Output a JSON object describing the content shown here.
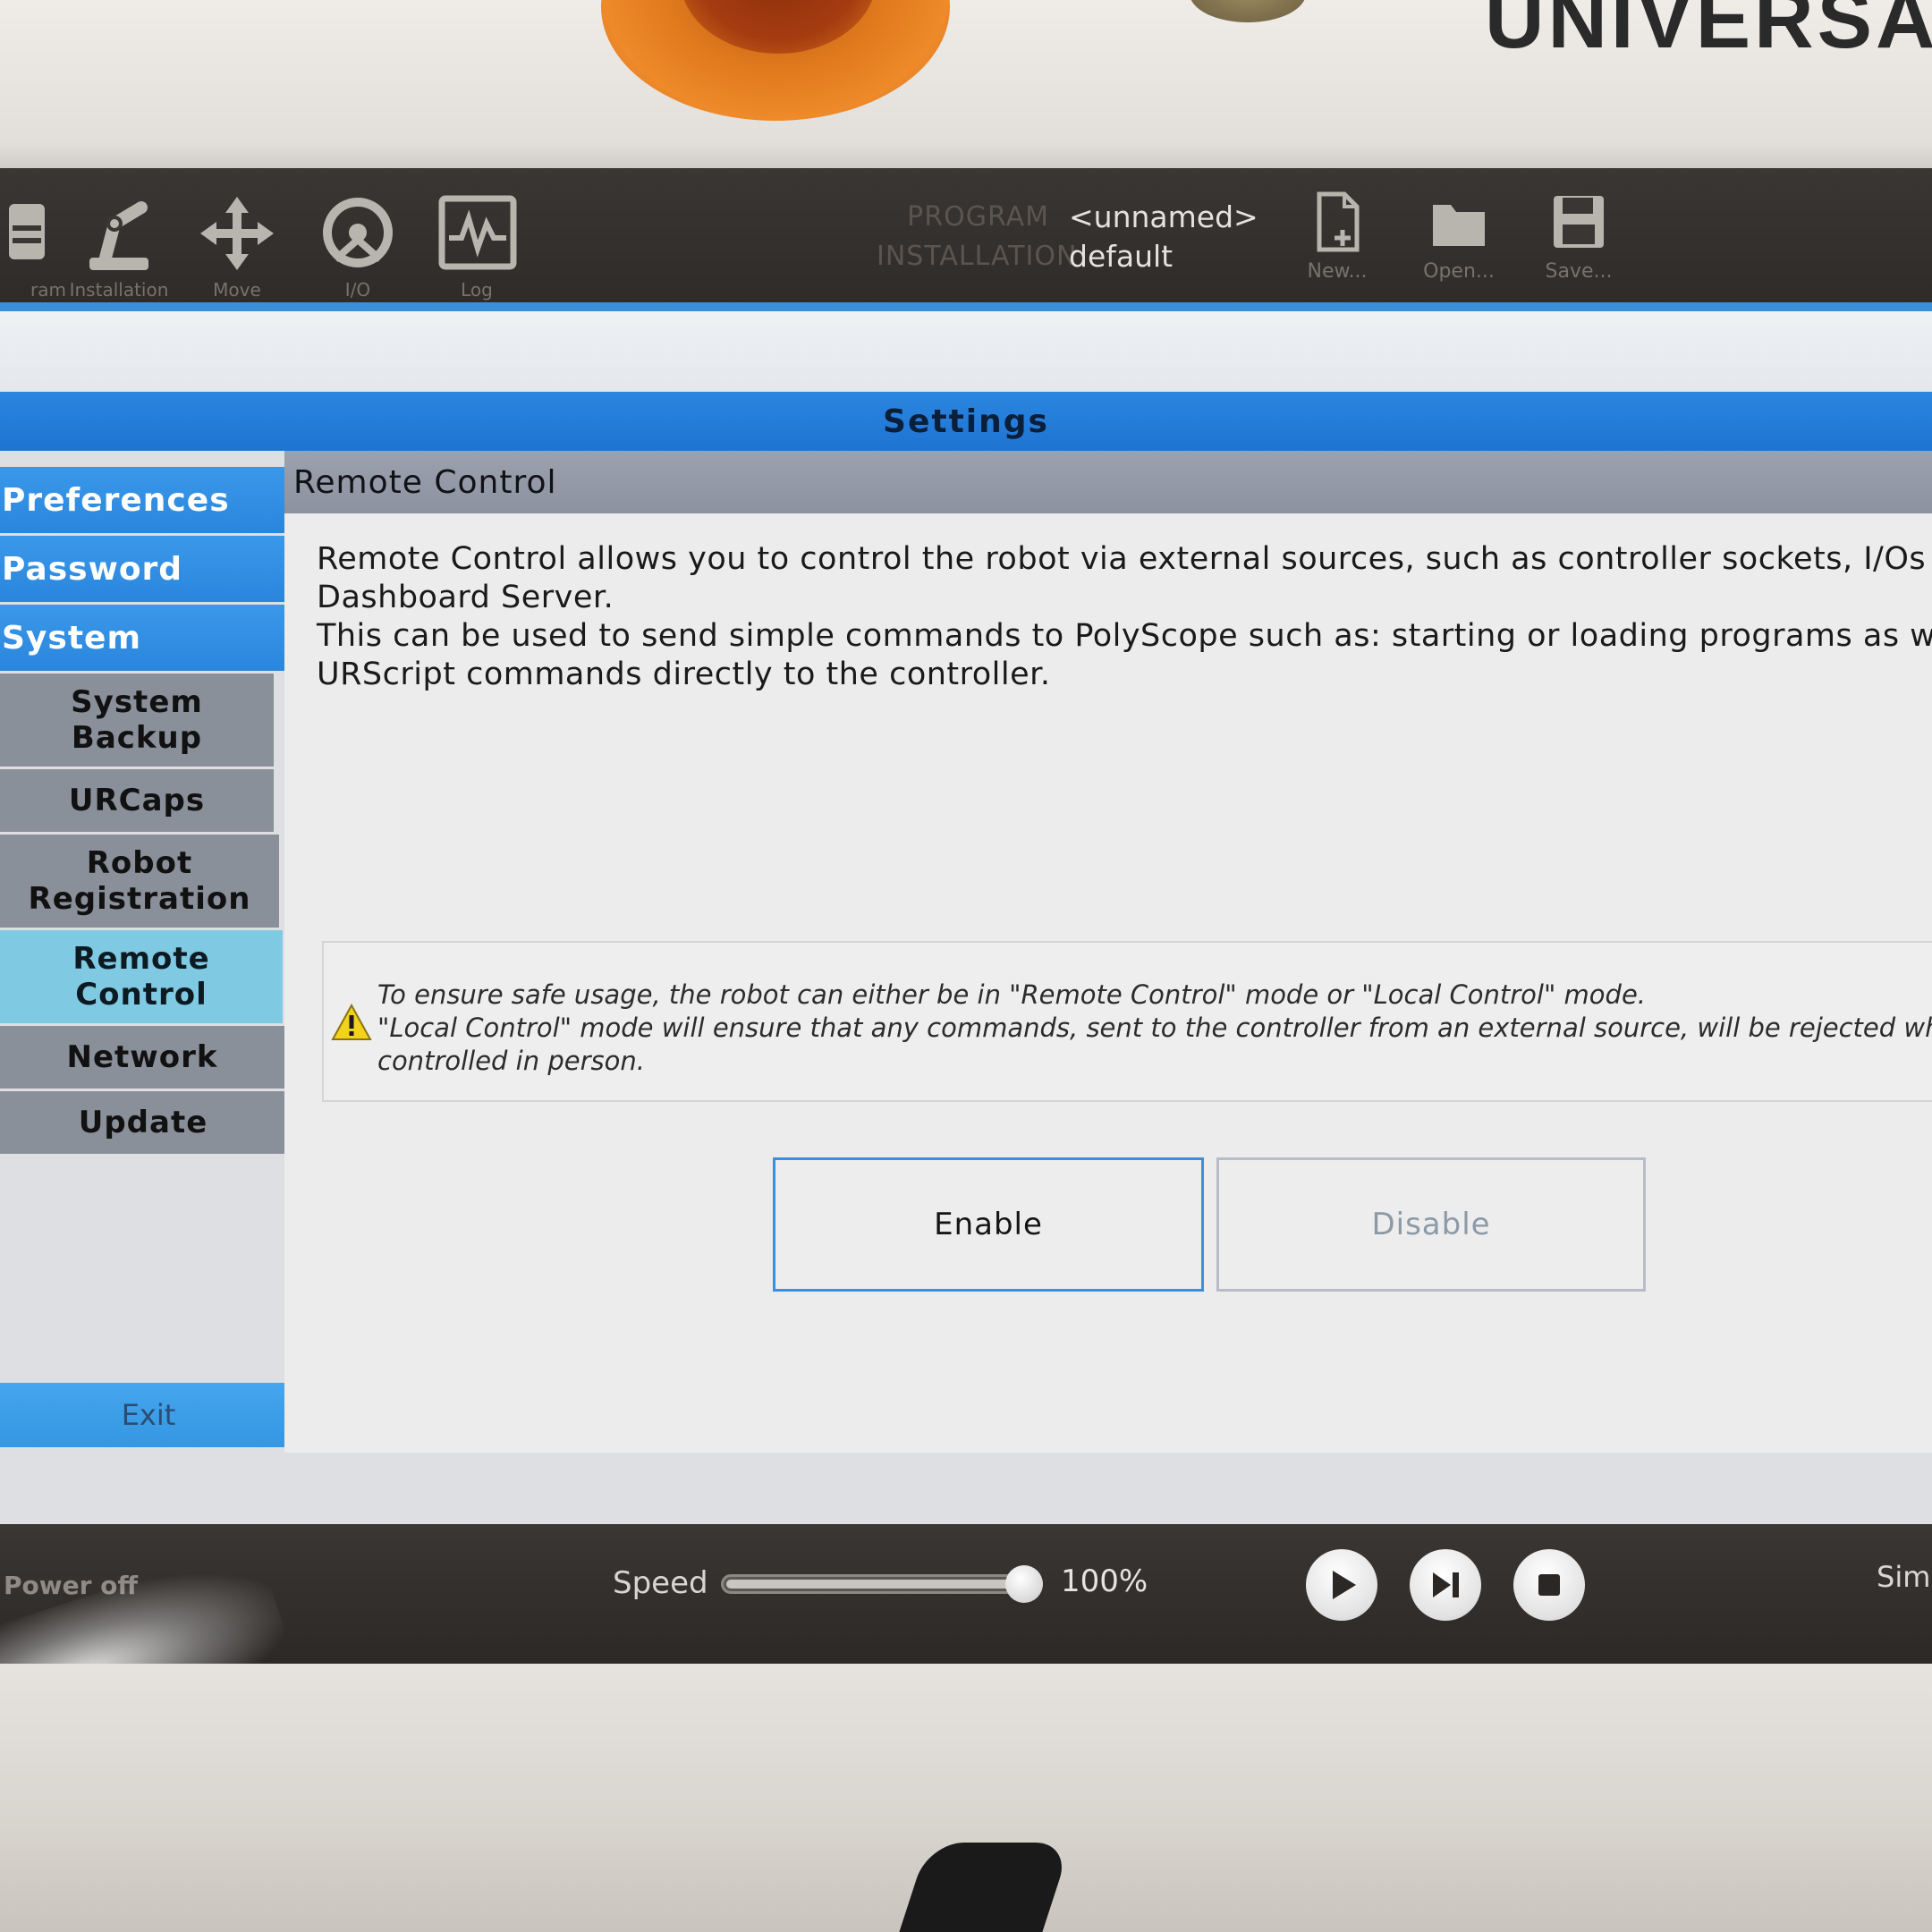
{
  "hardware": {
    "brand_text": "UNIVERSAL"
  },
  "toolbar": {
    "tabs": [
      {
        "label": "ram",
        "icon": "program-icon"
      },
      {
        "label": "Installation",
        "icon": "robot-arm-icon"
      },
      {
        "label": "Move",
        "icon": "move-arrows-icon"
      },
      {
        "label": "I/O",
        "icon": "io-icon"
      },
      {
        "label": "Log",
        "icon": "log-icon"
      }
    ],
    "program_label": "PROGRAM",
    "program_value": "<unnamed>",
    "installation_label": "INSTALLATION",
    "installation_value": "default",
    "file_buttons": [
      {
        "label": "New...",
        "icon": "new-file-icon"
      },
      {
        "label": "Open...",
        "icon": "open-folder-icon"
      },
      {
        "label": "Save...",
        "icon": "save-disk-icon"
      }
    ]
  },
  "title": "Settings",
  "sidebar": {
    "top_items": [
      "Preferences",
      "Password",
      "System"
    ],
    "sub_items": [
      "System Backup",
      "URCaps",
      "Robot Registration",
      "Remote Control",
      "Network",
      "Update"
    ],
    "active": "Remote Control",
    "exit_label": "Exit"
  },
  "panel": {
    "heading": "Remote Control",
    "description_lines": [
      "Remote Control allows you to control the robot via external sources, such as controller sockets, I/Os and",
      "Dashboard Server.",
      "This can be used to send simple commands to PolyScope such as: starting or loading programs as well as",
      "URScript commands directly to the controller."
    ],
    "notice_icon": "warning-icon",
    "notice_lines": [
      "To ensure safe usage, the robot can either be in \"Remote Control\" mode or \"Local Control\" mode.",
      "\"Local Control\" mode will ensure that any commands, sent to the controller from an external source, will be rejected while t",
      "controlled in person."
    ],
    "enable_label": "Enable",
    "disable_label": "Disable"
  },
  "bottom_bar": {
    "power_label": "Power off",
    "speed_label": "Speed",
    "speed_fraction": 1.0,
    "speed_value": "100%",
    "controls": [
      "play-icon",
      "step-icon",
      "stop-icon"
    ],
    "sim_label": "Sim"
  },
  "colors": {
    "accent_blue": "#2a86e0",
    "sidebar_active": "#7fc9e3",
    "sidebar_sub": "#8a909a",
    "warning_yellow": "#f2d21b"
  }
}
